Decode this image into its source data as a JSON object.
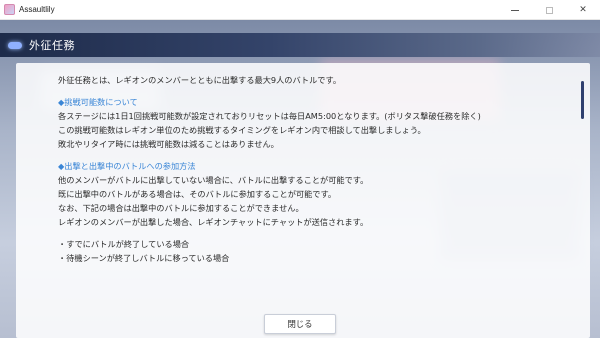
{
  "window": {
    "title": "Assaultlily"
  },
  "header": {
    "title": "外征任務"
  },
  "dialog": {
    "intro": "外征任務とは、レギオンのメンバーとともに出撃する最大9人のバトルです。",
    "sections": [
      {
        "heading": "◆挑戦可能数について",
        "lines": [
          "各ステージには1日1回挑戦可能数が設定されておりリセットは毎日AM5:00となります。(ボリタス撃破任務を除く)",
          "この挑戦可能数はレギオン単位のため挑戦するタイミングをレギオン内で相談して出撃しましょう。",
          "敗北やリタイア時には挑戦可能数は減ることはありません。"
        ]
      },
      {
        "heading": "◆出撃と出撃中のバトルへの参加方法",
        "lines": [
          "他のメンバーがバトルに出撃していない場合に、バトルに出撃することが可能です。",
          "既に出撃中のバトルがある場合は、そのバトルに参加することが可能です。",
          "なお、下記の場合は出撃中のバトルに参加することができません。",
          "レギオンのメンバーが出撃した場合、レギオンチャットにチャットが送信されます。"
        ]
      }
    ],
    "bullets": [
      "・すでにバトルが終了している場合",
      "・待機シーンが終了しバトルに移っている場合"
    ],
    "close_label": "閉じる"
  },
  "colors": {
    "section_heading": "#3a86d6",
    "header_bg": "#1e2b4a",
    "scrollbar": "#2e3f6e"
  },
  "icons": {
    "app": "assaultlily-app-icon",
    "minimize": "minimize-icon",
    "maximize": "maximize-icon",
    "close": "close-window-icon",
    "header": "header-pill-icon"
  }
}
